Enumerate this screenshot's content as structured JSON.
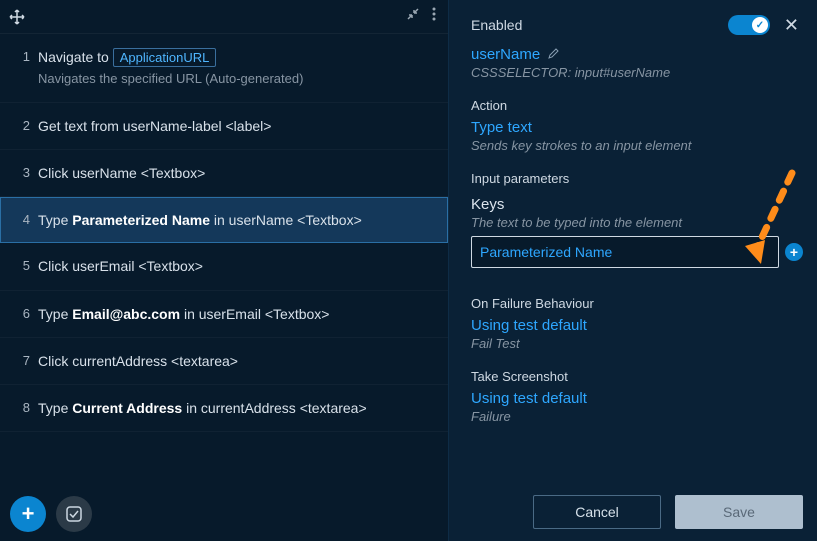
{
  "left": {
    "steps": [
      {
        "num": "1",
        "prefix": "Navigate to ",
        "chip": "ApplicationURL",
        "suffix": "",
        "sub": "Navigates the specified URL (Auto-generated)"
      },
      {
        "num": "2",
        "prefix": "Get text from userName-label <label>",
        "chip": "",
        "suffix": ""
      },
      {
        "num": "3",
        "prefix": "Click userName <Textbox>",
        "chip": "",
        "suffix": ""
      },
      {
        "num": "4",
        "prefix": "Type ",
        "bold": "Parameterized Name",
        "suffix": " in userName <Textbox>",
        "selected": true
      },
      {
        "num": "5",
        "prefix": "Click userEmail <Textbox>",
        "chip": "",
        "suffix": ""
      },
      {
        "num": "6",
        "prefix": "Type ",
        "bold": "Email@abc.com",
        "suffix": " in userEmail <Textbox>"
      },
      {
        "num": "7",
        "prefix": "Click currentAddress <textarea>",
        "chip": "",
        "suffix": ""
      },
      {
        "num": "8",
        "prefix": "Type ",
        "bold": "Current Address",
        "suffix": " in currentAddress <textarea>"
      }
    ]
  },
  "right": {
    "enabled_label": "Enabled",
    "field_name": "userName",
    "selector": "CSSSELECTOR: input#userName",
    "action_label": "Action",
    "action_name": "Type text",
    "action_desc": "Sends key strokes to an input element",
    "input_params_label": "Input parameters",
    "keys_label": "Keys",
    "keys_desc": "The text to be typed into the element",
    "keys_value": "Parameterized Name",
    "failure_label": "On Failure Behaviour",
    "failure_value": "Using test default",
    "failure_note": "Fail Test",
    "screenshot_label": "Take Screenshot",
    "screenshot_value": "Using test default",
    "screenshot_note": "Failure",
    "cancel": "Cancel",
    "save": "Save"
  }
}
